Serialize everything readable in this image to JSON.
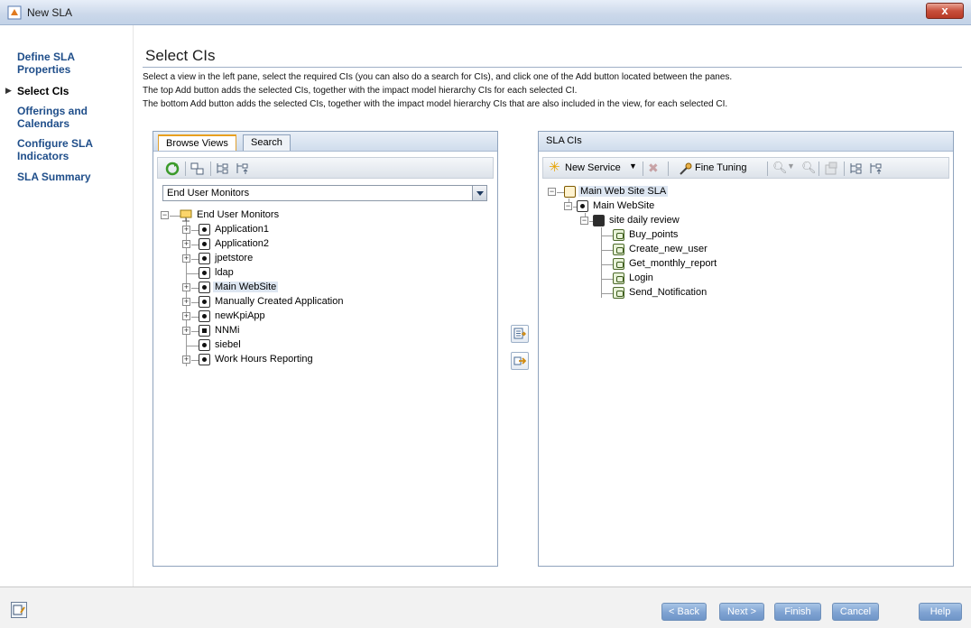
{
  "window": {
    "title": "New SLA",
    "close_label": "x"
  },
  "nav": {
    "items": [
      {
        "label": "Define SLA Properties"
      },
      {
        "label": "Select CIs",
        "active": true
      },
      {
        "label": "Offerings and Calendars"
      },
      {
        "label": "Configure SLA Indicators"
      },
      {
        "label": "SLA Summary"
      }
    ]
  },
  "main": {
    "title": "Select CIs",
    "description": [
      "Select a view in the left pane, select the required CIs (you can also do a search for CIs), and click one of the Add button located between the panes.",
      "The top Add button adds the selected CIs, together with the impact model hierarchy CIs for each selected CI.",
      "The bottom Add button adds the selected CIs, together with the impact model hierarchy CIs that are also included in the view, for each selected CI."
    ]
  },
  "left_panel": {
    "tabs": [
      {
        "label": "Browse Views",
        "active": true
      },
      {
        "label": "Search"
      }
    ],
    "view_select": {
      "value": "End User Monitors"
    },
    "tree": {
      "root": "End User Monitors",
      "children": [
        {
          "label": "Application1",
          "expandable": true,
          "icon": "app"
        },
        {
          "label": "Application2",
          "expandable": true,
          "icon": "app"
        },
        {
          "label": "jpetstore",
          "expandable": true,
          "icon": "app"
        },
        {
          "label": "ldap",
          "expandable": false,
          "icon": "app"
        },
        {
          "label": "Main WebSite",
          "expandable": true,
          "icon": "app",
          "selected": true
        },
        {
          "label": "Manually Created Application",
          "expandable": true,
          "icon": "app"
        },
        {
          "label": "newKpiApp",
          "expandable": true,
          "icon": "app"
        },
        {
          "label": "NNMi",
          "expandable": true,
          "icon": "nnmi"
        },
        {
          "label": "siebel",
          "expandable": false,
          "icon": "app"
        },
        {
          "label": "Work Hours Reporting",
          "expandable": true,
          "icon": "app"
        }
      ]
    }
  },
  "right_panel": {
    "title": "SLA CIs",
    "toolbar": {
      "new_service": "New Service",
      "fine_tuning": "Fine Tuning"
    },
    "tree": {
      "root": "Main Web Site SLA",
      "level1": "Main WebSite",
      "level2": "site daily review",
      "transactions": [
        "Buy_points",
        "Create_new_user",
        "Get_monthly_report",
        "Login",
        "Send_Notification"
      ]
    }
  },
  "footer": {
    "back": "< Back",
    "next": "Next >",
    "finish": "Finish",
    "cancel": "Cancel",
    "help": "Help"
  }
}
